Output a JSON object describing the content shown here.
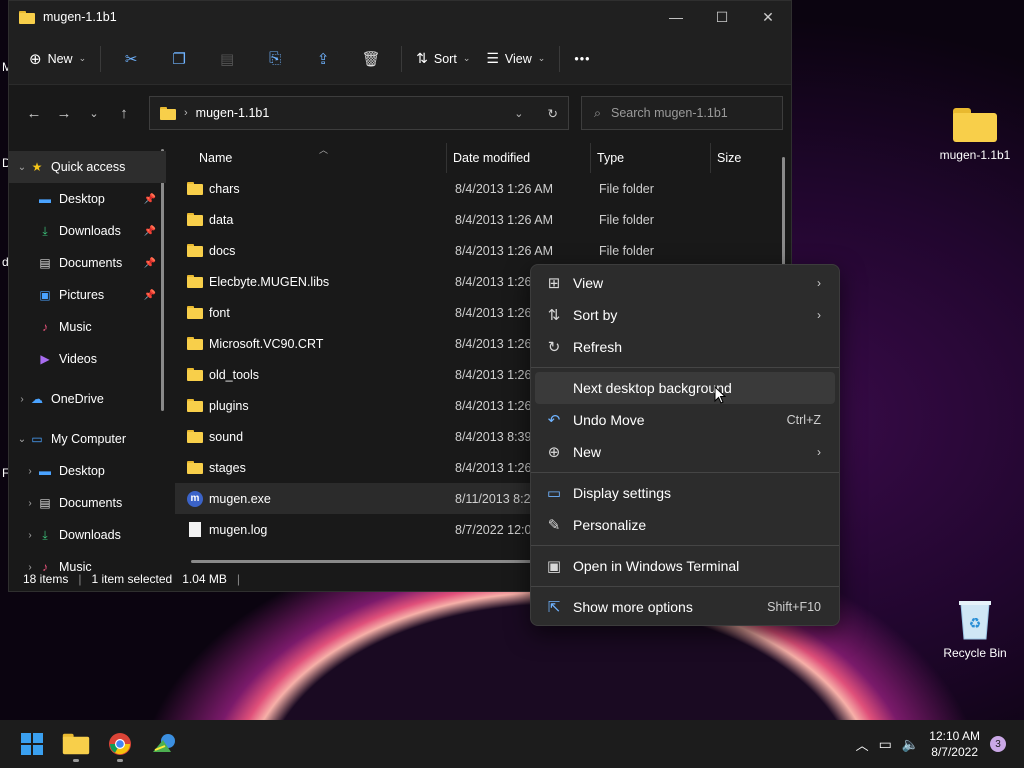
{
  "desktop": {
    "icons": [
      {
        "label": "mugen-1.1b1",
        "icon": "folder-icon"
      },
      {
        "label": "Recycle Bin",
        "icon": "recycle-bin-icon"
      }
    ],
    "edge_letters": [
      "M",
      "D",
      "d",
      "F"
    ]
  },
  "explorer": {
    "title": "mugen-1.1b1",
    "window_buttons": [
      "—",
      "☐",
      "✕"
    ],
    "commandbar": {
      "new_label": "New",
      "sort_label": "Sort",
      "view_label": "View",
      "more_label": "•••"
    },
    "address": {
      "path": "mugen-1.1b1",
      "search_placeholder": "Search mugen-1.1b1"
    },
    "nav": {
      "items": [
        {
          "label": "Quick access",
          "icon": "star-icon",
          "chevron": "v",
          "pinned": false,
          "selected": true,
          "indent": 0
        },
        {
          "label": "Desktop",
          "icon": "desktop-icon",
          "chevron": "",
          "pinned": true,
          "indent": 1
        },
        {
          "label": "Downloads",
          "icon": "download-icon",
          "chevron": "",
          "pinned": true,
          "indent": 1
        },
        {
          "label": "Documents",
          "icon": "document-icon",
          "chevron": "",
          "pinned": true,
          "indent": 1
        },
        {
          "label": "Pictures",
          "icon": "picture-icon",
          "chevron": "",
          "pinned": true,
          "indent": 1
        },
        {
          "label": "Music",
          "icon": "music-icon",
          "chevron": "",
          "pinned": false,
          "indent": 1
        },
        {
          "label": "Videos",
          "icon": "video-icon",
          "chevron": "",
          "pinned": false,
          "indent": 1
        },
        {
          "label": "OneDrive",
          "icon": "cloud-icon",
          "chevron": ">",
          "pinned": false,
          "indent": 0
        },
        {
          "label": "My Computer",
          "icon": "computer-icon",
          "chevron": "v",
          "pinned": false,
          "indent": 0
        },
        {
          "label": "Desktop",
          "icon": "desktop-icon",
          "chevron": ">",
          "pinned": false,
          "indent": 1
        },
        {
          "label": "Documents",
          "icon": "document-icon",
          "chevron": ">",
          "pinned": false,
          "indent": 1
        },
        {
          "label": "Downloads",
          "icon": "download-icon",
          "chevron": ">",
          "pinned": false,
          "indent": 1
        },
        {
          "label": "Music",
          "icon": "music-icon",
          "chevron": ">",
          "pinned": false,
          "indent": 1
        }
      ]
    },
    "columns": [
      "Name",
      "Date modified",
      "Type",
      "Size"
    ],
    "files": [
      {
        "name": "chars",
        "date": "8/4/2013 1:26 AM",
        "type": "File folder",
        "kind": "folder"
      },
      {
        "name": "data",
        "date": "8/4/2013 1:26 AM",
        "type": "File folder",
        "kind": "folder"
      },
      {
        "name": "docs",
        "date": "8/4/2013 1:26 AM",
        "type": "File folder",
        "kind": "folder"
      },
      {
        "name": "Elecbyte.MUGEN.libs",
        "date": "8/4/2013 1:26 AM",
        "type": "",
        "kind": "folder"
      },
      {
        "name": "font",
        "date": "8/4/2013 1:26 AM",
        "type": "",
        "kind": "folder"
      },
      {
        "name": "Microsoft.VC90.CRT",
        "date": "8/4/2013 1:26 AM",
        "type": "",
        "kind": "folder"
      },
      {
        "name": "old_tools",
        "date": "8/4/2013 1:26 AM",
        "type": "",
        "kind": "folder"
      },
      {
        "name": "plugins",
        "date": "8/4/2013 1:26 AM",
        "type": "",
        "kind": "folder"
      },
      {
        "name": "sound",
        "date": "8/4/2013 8:39 AM",
        "type": "",
        "kind": "folder"
      },
      {
        "name": "stages",
        "date": "8/4/2013 1:26 AM",
        "type": "",
        "kind": "folder"
      },
      {
        "name": "mugen.exe",
        "date": "8/11/2013 8:23 AM",
        "type": "",
        "kind": "exe",
        "selected": true
      },
      {
        "name": "mugen.log",
        "date": "8/7/2022 12:07 AM",
        "type": "",
        "kind": "file"
      }
    ],
    "status": {
      "count": "18 items",
      "selected": "1 item selected",
      "size": "1.04 MB"
    }
  },
  "context_menu": {
    "items": [
      {
        "label": "View",
        "icon": "grid-icon",
        "submenu": true,
        "shortcut": ""
      },
      {
        "label": "Sort by",
        "icon": "sort-icon",
        "submenu": true,
        "shortcut": ""
      },
      {
        "label": "Refresh",
        "icon": "refresh-icon",
        "submenu": false,
        "shortcut": ""
      },
      {
        "sep": true
      },
      {
        "label": "Next desktop background",
        "icon": "",
        "submenu": false,
        "shortcut": "",
        "hover": true
      },
      {
        "label": "Undo Move",
        "icon": "undo-icon",
        "submenu": false,
        "shortcut": "Ctrl+Z"
      },
      {
        "label": "New",
        "icon": "plus-circle-icon",
        "submenu": true,
        "shortcut": ""
      },
      {
        "sep": true
      },
      {
        "label": "Display settings",
        "icon": "display-icon",
        "submenu": false,
        "shortcut": ""
      },
      {
        "label": "Personalize",
        "icon": "brush-icon",
        "submenu": false,
        "shortcut": ""
      },
      {
        "sep": true
      },
      {
        "label": "Open in Windows Terminal",
        "icon": "terminal-icon",
        "submenu": false,
        "shortcut": ""
      },
      {
        "sep": true
      },
      {
        "label": "Show more options",
        "icon": "share-icon",
        "submenu": false,
        "shortcut": "Shift+F10"
      }
    ]
  },
  "taskbar": {
    "apps": [
      "windows-start-icon",
      "file-explorer-icon",
      "chrome-icon",
      "network-app-icon"
    ],
    "time": "12:10 AM",
    "date": "8/7/2022",
    "notifications": "3"
  }
}
